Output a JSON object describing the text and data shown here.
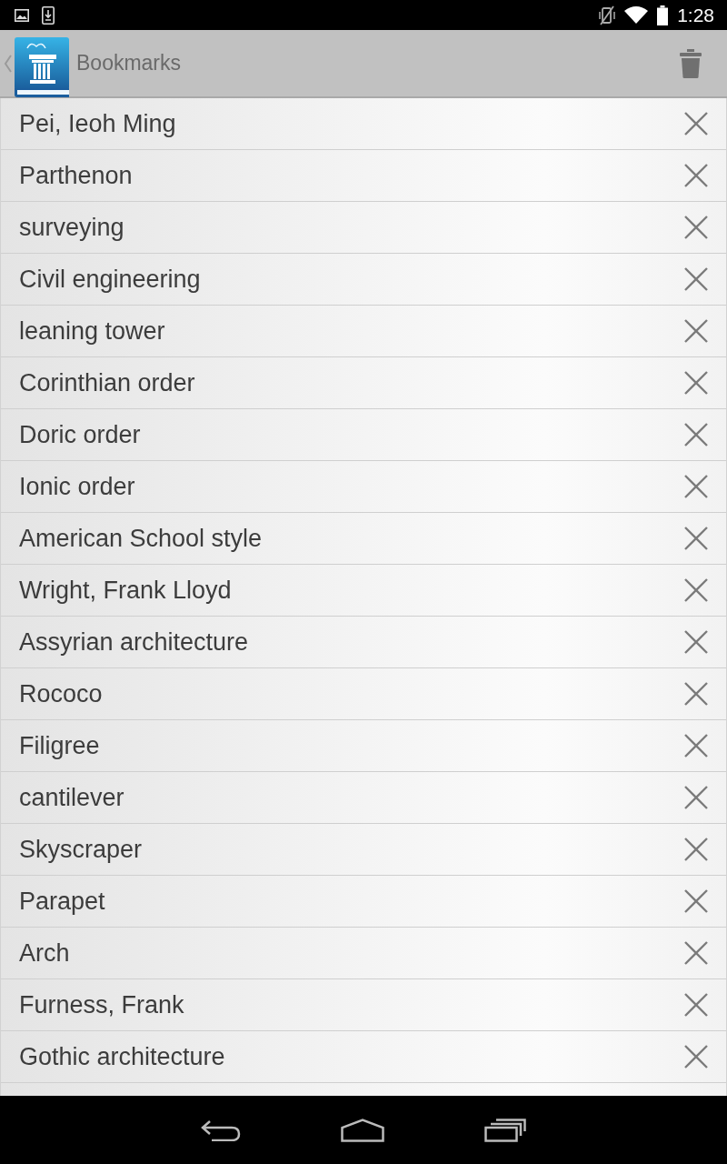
{
  "status_bar": {
    "time": "1:28"
  },
  "action_bar": {
    "title": "Bookmarks"
  },
  "bookmarks": [
    {
      "label": "Pei, Ieoh Ming"
    },
    {
      "label": "Parthenon"
    },
    {
      "label": "surveying"
    },
    {
      "label": "Civil engineering"
    },
    {
      "label": "leaning tower"
    },
    {
      "label": "Corinthian order"
    },
    {
      "label": "Doric order"
    },
    {
      "label": "Ionic order"
    },
    {
      "label": "American School style"
    },
    {
      "label": "Wright, Frank Lloyd"
    },
    {
      "label": "Assyrian architecture"
    },
    {
      "label": "Rococo"
    },
    {
      "label": "Filigree"
    },
    {
      "label": "cantilever"
    },
    {
      "label": "Skyscraper"
    },
    {
      "label": "Parapet"
    },
    {
      "label": "Arch"
    },
    {
      "label": "Furness, Frank"
    },
    {
      "label": "Gothic architecture"
    }
  ]
}
